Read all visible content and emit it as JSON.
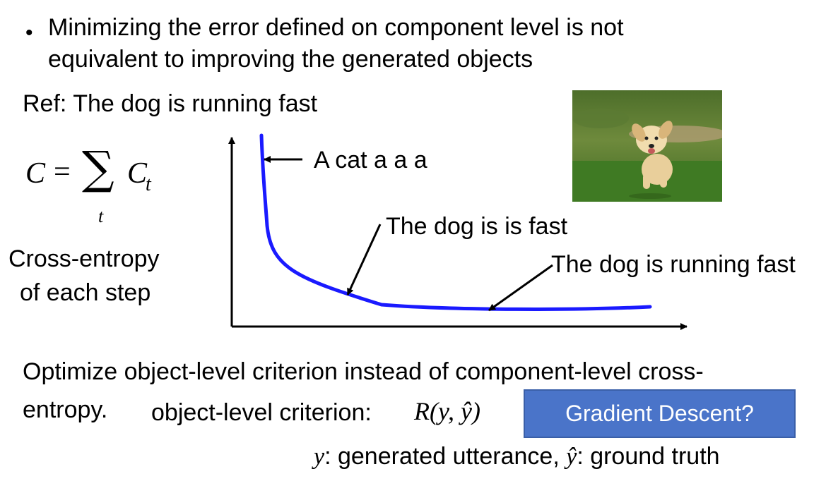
{
  "bullet": {
    "line1": "Minimizing the error defined on component level is not",
    "line2": "equivalent to improving the generated objects"
  },
  "ref": "Ref: The dog is running fast",
  "formula": {
    "lhs": "C",
    "eq": "=",
    "sum": "∑",
    "sub": "t",
    "term": "C",
    "term_sub": "t"
  },
  "formula_caption": {
    "line1": "Cross-entropy",
    "line2": "of each step"
  },
  "annotations": {
    "a1": "A cat a a a",
    "a2": "The dog is is fast",
    "a3": "The dog is running fast"
  },
  "bottom": {
    "line1": "Optimize object-level criterion instead of component-level cross-",
    "line2_a": "entropy.",
    "line2_b": "object-level criterion:",
    "criterion": "R(y, ŷ)",
    "line3_y": "y",
    "line3_text1": ": generated utterance, ",
    "line3_yhat": "ŷ",
    "line3_text2": ": ground truth"
  },
  "button": {
    "label": "Gradient Descent?"
  },
  "colors": {
    "curve": "#1a1aff",
    "button": "#4a74c9"
  },
  "photo": {
    "subject": "puppy-running-on-grass"
  }
}
